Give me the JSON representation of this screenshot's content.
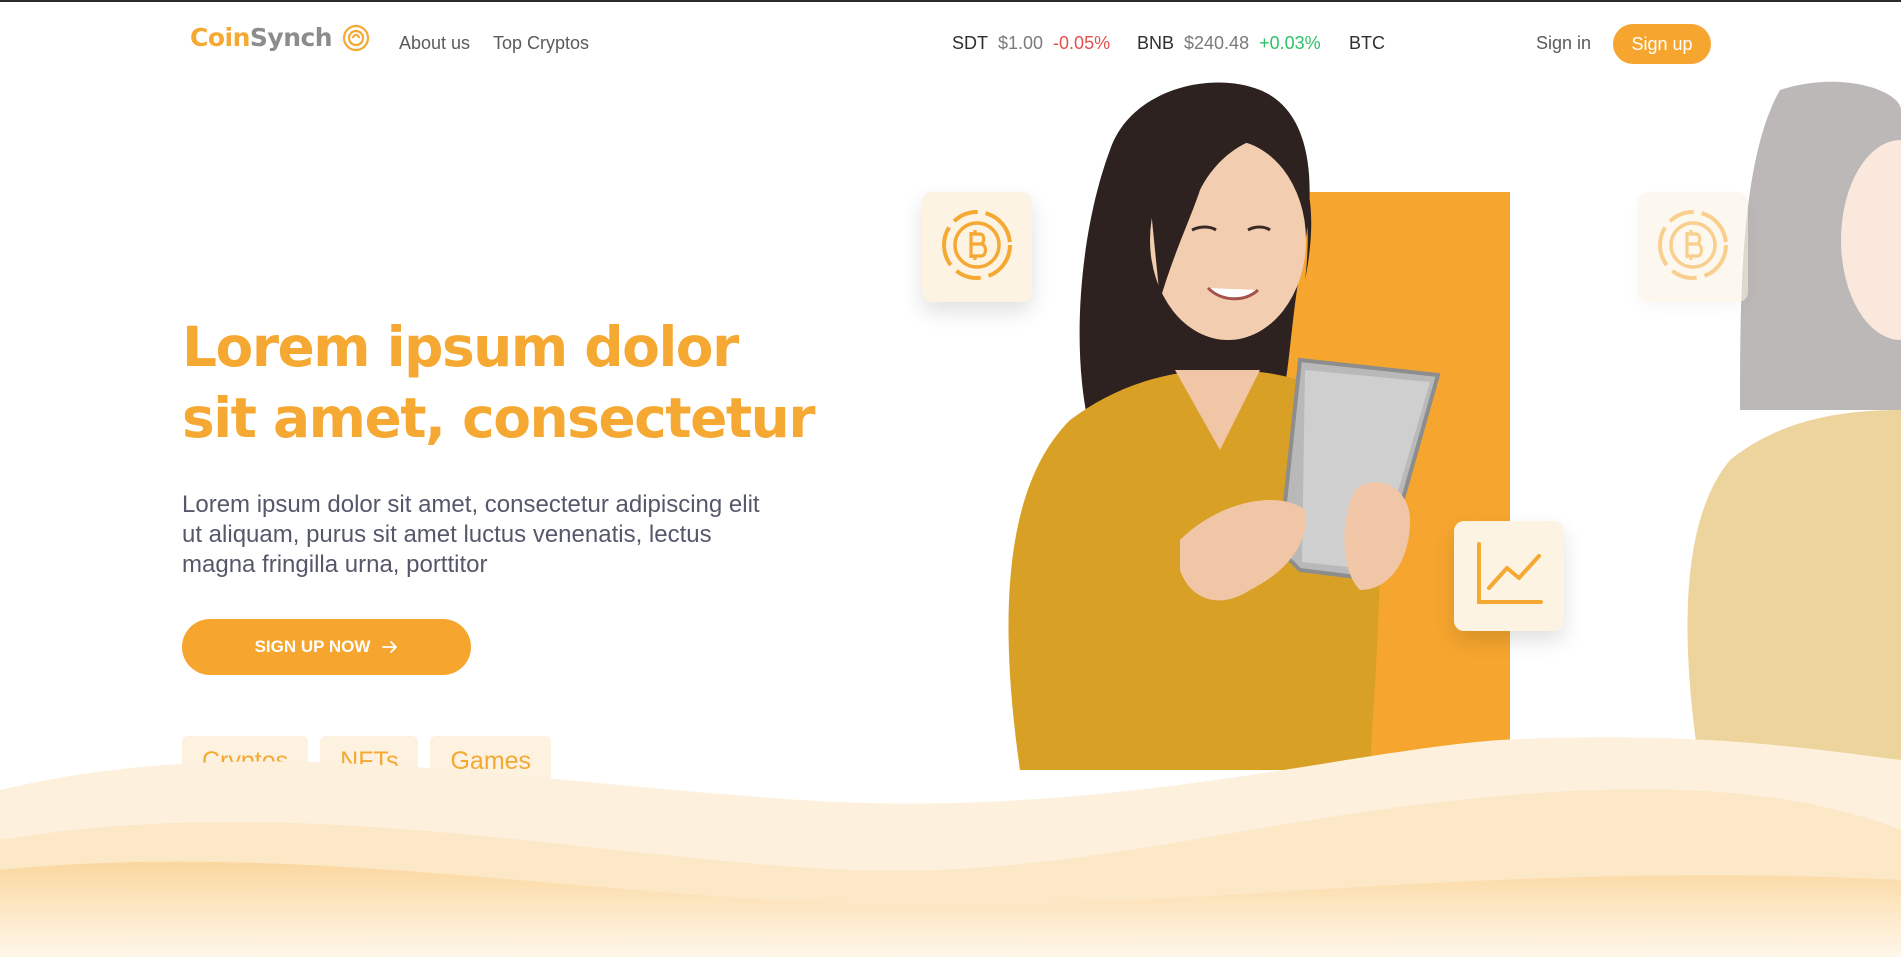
{
  "brand": {
    "name_part1": "Coin",
    "name_part2": "Synch",
    "accent_color": "#f6a62e"
  },
  "nav": {
    "about": "About us",
    "top_cryptos": "Top Cryptos"
  },
  "ticker": [
    {
      "symbol": "SDT",
      "price": "$1.00",
      "change": "-0.05%",
      "direction": "down"
    },
    {
      "symbol": "BNB",
      "price": "$240.48",
      "change": "+0.03%",
      "direction": "up"
    },
    {
      "symbol": "BTC"
    }
  ],
  "auth": {
    "sign_in": "Sign in",
    "sign_up": "Sign up"
  },
  "hero": {
    "title_line1": "Lorem ipsum dolor",
    "title_line2": "sit amet, consectetur",
    "description": "Lorem ipsum dolor sit amet, consectetur adipiscing elit ut aliquam, purus sit amet luctus venenatis, lectus magna fringilla urna, porttitor",
    "cta": "SIGN UP NOW",
    "tags": [
      "Cryptos",
      "NFTs",
      "Games"
    ]
  },
  "icons": {
    "logo": "coin-logo-icon",
    "cta_arrow": "arrow-right-icon",
    "card1": "bitcoin-icon",
    "card2": "line-chart-icon"
  },
  "colors": {
    "negative": "#e3504b",
    "positive": "#2ec16a",
    "tag_bg": "#fdf1df"
  }
}
